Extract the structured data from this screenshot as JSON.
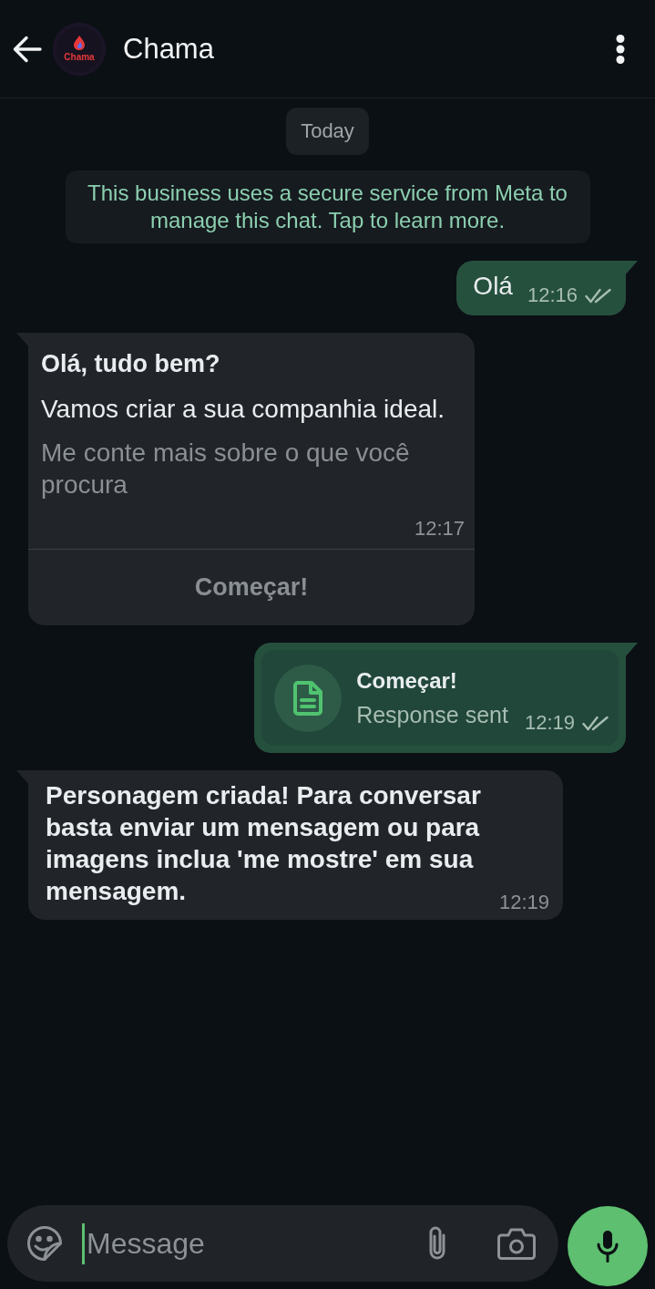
{
  "header": {
    "title": "Chama",
    "avatar": {
      "logo_text": "Chama"
    }
  },
  "date_chip": "Today",
  "notice": "This business uses a secure service from Meta to manage this chat. Tap to learn more.",
  "messages": [
    {
      "kind": "text",
      "outgoing": true,
      "text": "Olá",
      "bold": false,
      "time": "12:16",
      "delivered": true,
      "read": false
    },
    {
      "kind": "interactive",
      "outgoing": false,
      "title": "Olá, tudo bem?",
      "body": "Vamos criar a sua companhia ideal.",
      "footer": "Me conte mais sobre o que você procura",
      "time": "12:17",
      "button": {
        "label": "Começar!",
        "disabled": true
      }
    },
    {
      "kind": "response",
      "outgoing": true,
      "title": "Começar!",
      "subtitle": "Response sent",
      "time": "12:19",
      "delivered": true,
      "read": false
    },
    {
      "kind": "text",
      "outgoing": false,
      "text": "Personagem criada! Para conversar basta enviar um mensagem ou para imagens inclua 'me mostre' em sua mensagem.",
      "bold": true,
      "time": "12:19"
    }
  ],
  "composer": {
    "placeholder": "Message"
  }
}
